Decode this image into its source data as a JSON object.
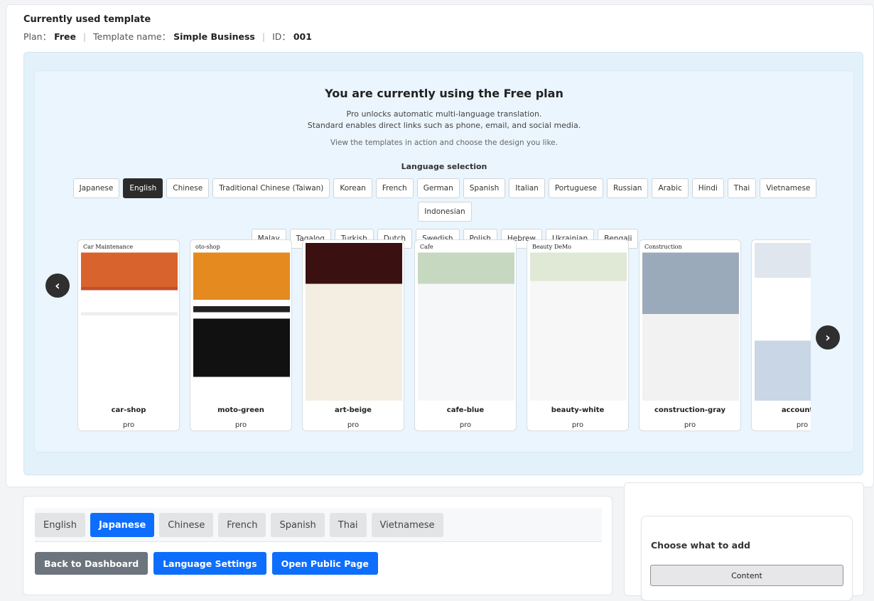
{
  "current": {
    "title": "Currently used template",
    "plan_label": "Plan：",
    "plan_value": "Free",
    "template_label": "Template name：",
    "template_value": "Simple Business",
    "id_label": "ID：",
    "id_value": "001"
  },
  "plan_panel": {
    "title": "You are currently using the Free plan",
    "line1": "Pro unlocks automatic multi-language translation.",
    "line2": "Standard enables direct links such as phone, email, and social media.",
    "view_text": "View the templates in action and choose the design you like.",
    "lang_title": "Language selection",
    "languages_row1": [
      "Japanese",
      "English",
      "Chinese",
      "Traditional Chinese (Taiwan)",
      "Korean",
      "French",
      "German",
      "Spanish",
      "Italian",
      "Portuguese",
      "Russian",
      "Arabic",
      "Hindi",
      "Thai",
      "Vietnamese",
      "Indonesian"
    ],
    "languages_row2": [
      "Malay",
      "Tagalog",
      "Turkish",
      "Dutch",
      "Swedish",
      "Polish",
      "Hebrew",
      "Ukrainian",
      "Bengali"
    ],
    "active_language": "English"
  },
  "templates": [
    {
      "name": "car-shop",
      "plan": "pro",
      "thumb_label": "Car Maintenance"
    },
    {
      "name": "moto-green",
      "plan": "pro",
      "thumb_label": "oto-shop"
    },
    {
      "name": "art-beige",
      "plan": "pro",
      "thumb_label": ""
    },
    {
      "name": "cafe-blue",
      "plan": "pro",
      "thumb_label": "Cafe"
    },
    {
      "name": "beauty-white",
      "plan": "pro",
      "thumb_label": "Beauty DeMo"
    },
    {
      "name": "construction-gray",
      "plan": "pro",
      "thumb_label": "Construction"
    },
    {
      "name": "accountan",
      "plan": "pro",
      "thumb_label": ""
    }
  ],
  "carousel": {
    "prev_icon": "chevron-left-icon",
    "next_icon": "chevron-right-icon",
    "prev_glyph": "‹",
    "next_glyph": "›"
  },
  "editor": {
    "tabs": [
      "English",
      "Japanese",
      "Chinese",
      "French",
      "Spanish",
      "Thai",
      "Vietnamese"
    ],
    "active_tab": "Japanese",
    "back_label": "Back to Dashboard",
    "lang_settings_label": "Language Settings",
    "open_public_label": "Open Public Page"
  },
  "side": {
    "title": "Choose what to add",
    "content_button": "Content"
  },
  "colors": {
    "primary": "#0d6efd",
    "secondary": "#6c757d",
    "dark": "#2b2b2b",
    "panel_bg": "#e3f1fb"
  }
}
